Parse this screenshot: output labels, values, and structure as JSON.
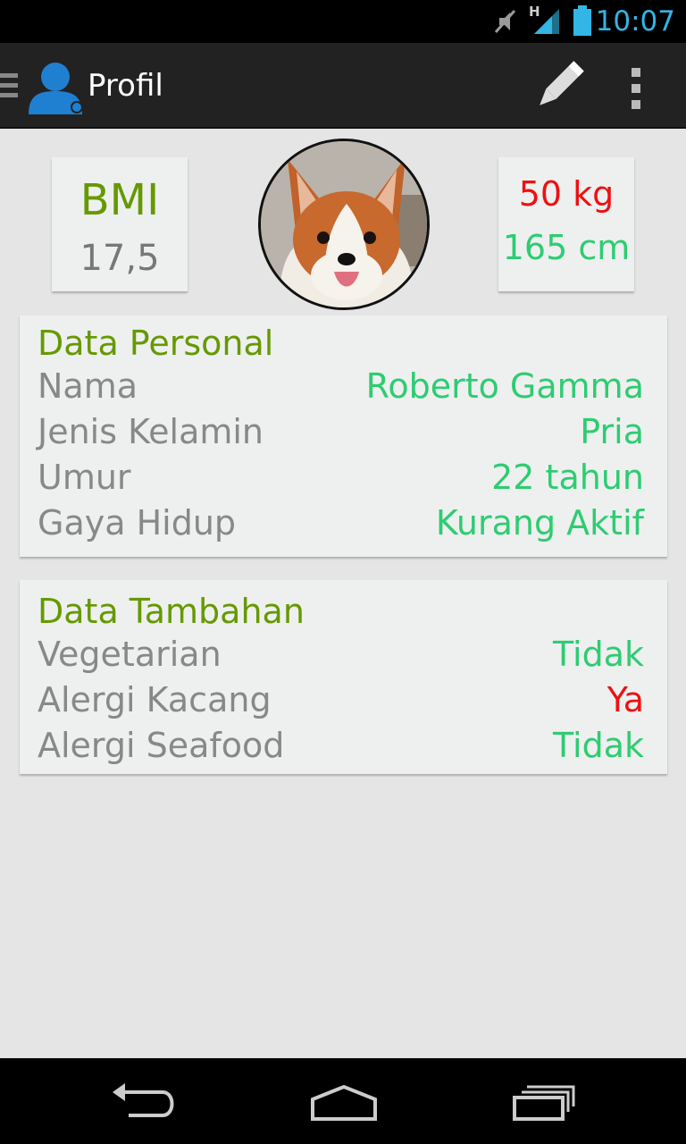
{
  "status_bar": {
    "time": "10:07",
    "network_label": "H",
    "icons": [
      "mute-icon",
      "signal-icon",
      "battery-icon"
    ],
    "accent_color": "#33b5e5"
  },
  "action_bar": {
    "title": "Profil",
    "icons": [
      "drawer-icon",
      "profile-icon",
      "pencil-icon",
      "overflow-menu-icon"
    ]
  },
  "bmi": {
    "label": "BMI",
    "value": "17,5"
  },
  "measurements": {
    "weight": "50 kg",
    "height": "165 cm"
  },
  "personal": {
    "heading": "Data Personal",
    "rows": [
      {
        "label": "Nama",
        "value": "Roberto Gamma",
        "status": "green"
      },
      {
        "label": "Jenis Kelamin",
        "value": "Pria",
        "status": "green"
      },
      {
        "label": "Umur",
        "value": "22 tahun",
        "status": "green"
      },
      {
        "label": "Gaya Hidup",
        "value": "Kurang Aktif",
        "status": "green"
      }
    ]
  },
  "tambahan": {
    "heading": "Data Tambahan",
    "rows": [
      {
        "label": "Vegetarian",
        "value": "Tidak",
        "status": "green"
      },
      {
        "label": "Alergi Kacang",
        "value": "Ya",
        "status": "red"
      },
      {
        "label": "Alergi Seafood",
        "value": "Tidak",
        "status": "green"
      }
    ]
  },
  "colors": {
    "heading_green": "#669900",
    "value_green": "#2ecc71",
    "value_red": "#ee1111",
    "label_gray": "#888888"
  },
  "nav_bar": {
    "icons": [
      "back-icon",
      "home-icon",
      "recent-apps-icon"
    ]
  }
}
